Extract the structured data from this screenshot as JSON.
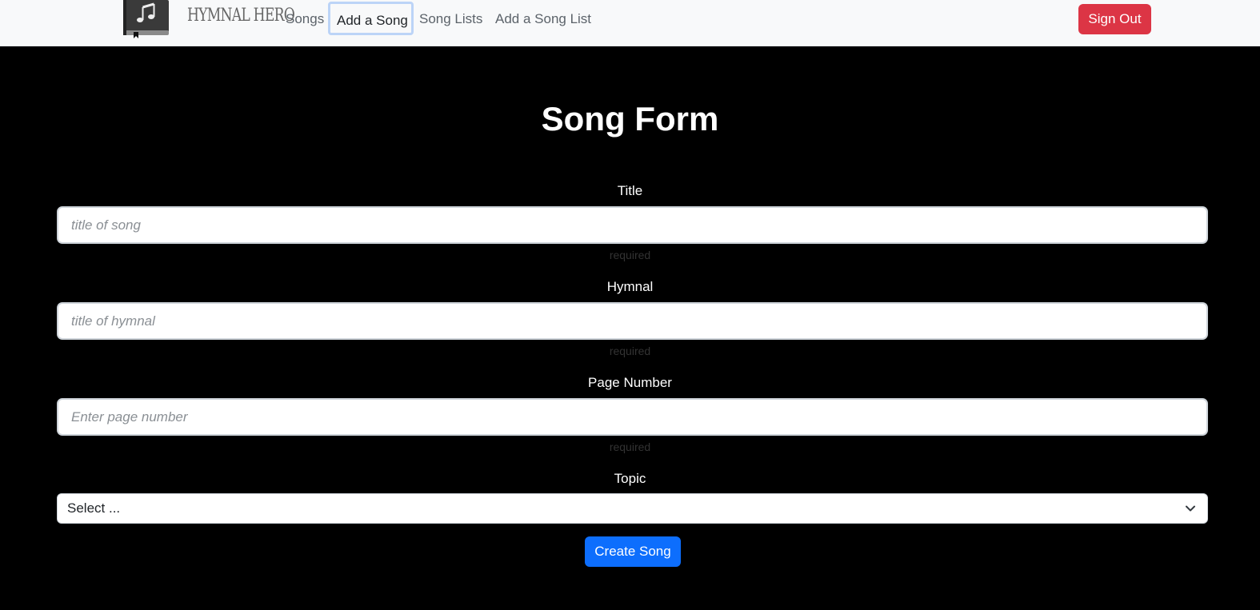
{
  "nav": {
    "brand": "HYMNAL HERO",
    "links": [
      "Songs",
      "Add a Song",
      "Song Lists",
      "Add a Song List"
    ],
    "signout": "Sign Out"
  },
  "form": {
    "title": "Song Form",
    "fields": {
      "title": {
        "label": "Title",
        "placeholder": "title of song",
        "value": "",
        "hint": "required"
      },
      "hymnal": {
        "label": "Hymnal",
        "placeholder": "title of hymnal",
        "value": "",
        "hint": "required"
      },
      "page": {
        "label": "Page Number",
        "placeholder": "Enter page number",
        "value": "",
        "hint": "required"
      },
      "topic": {
        "label": "Topic",
        "selected": "Select ..."
      }
    },
    "submit": "Create Song"
  },
  "icons": {
    "logo": "hymnal-book-icon",
    "select": "chevron-down-icon"
  },
  "colors": {
    "primary": "#0d6efd",
    "danger": "#dc3545",
    "navbar": "#f8f9fa",
    "background": "#000000"
  }
}
